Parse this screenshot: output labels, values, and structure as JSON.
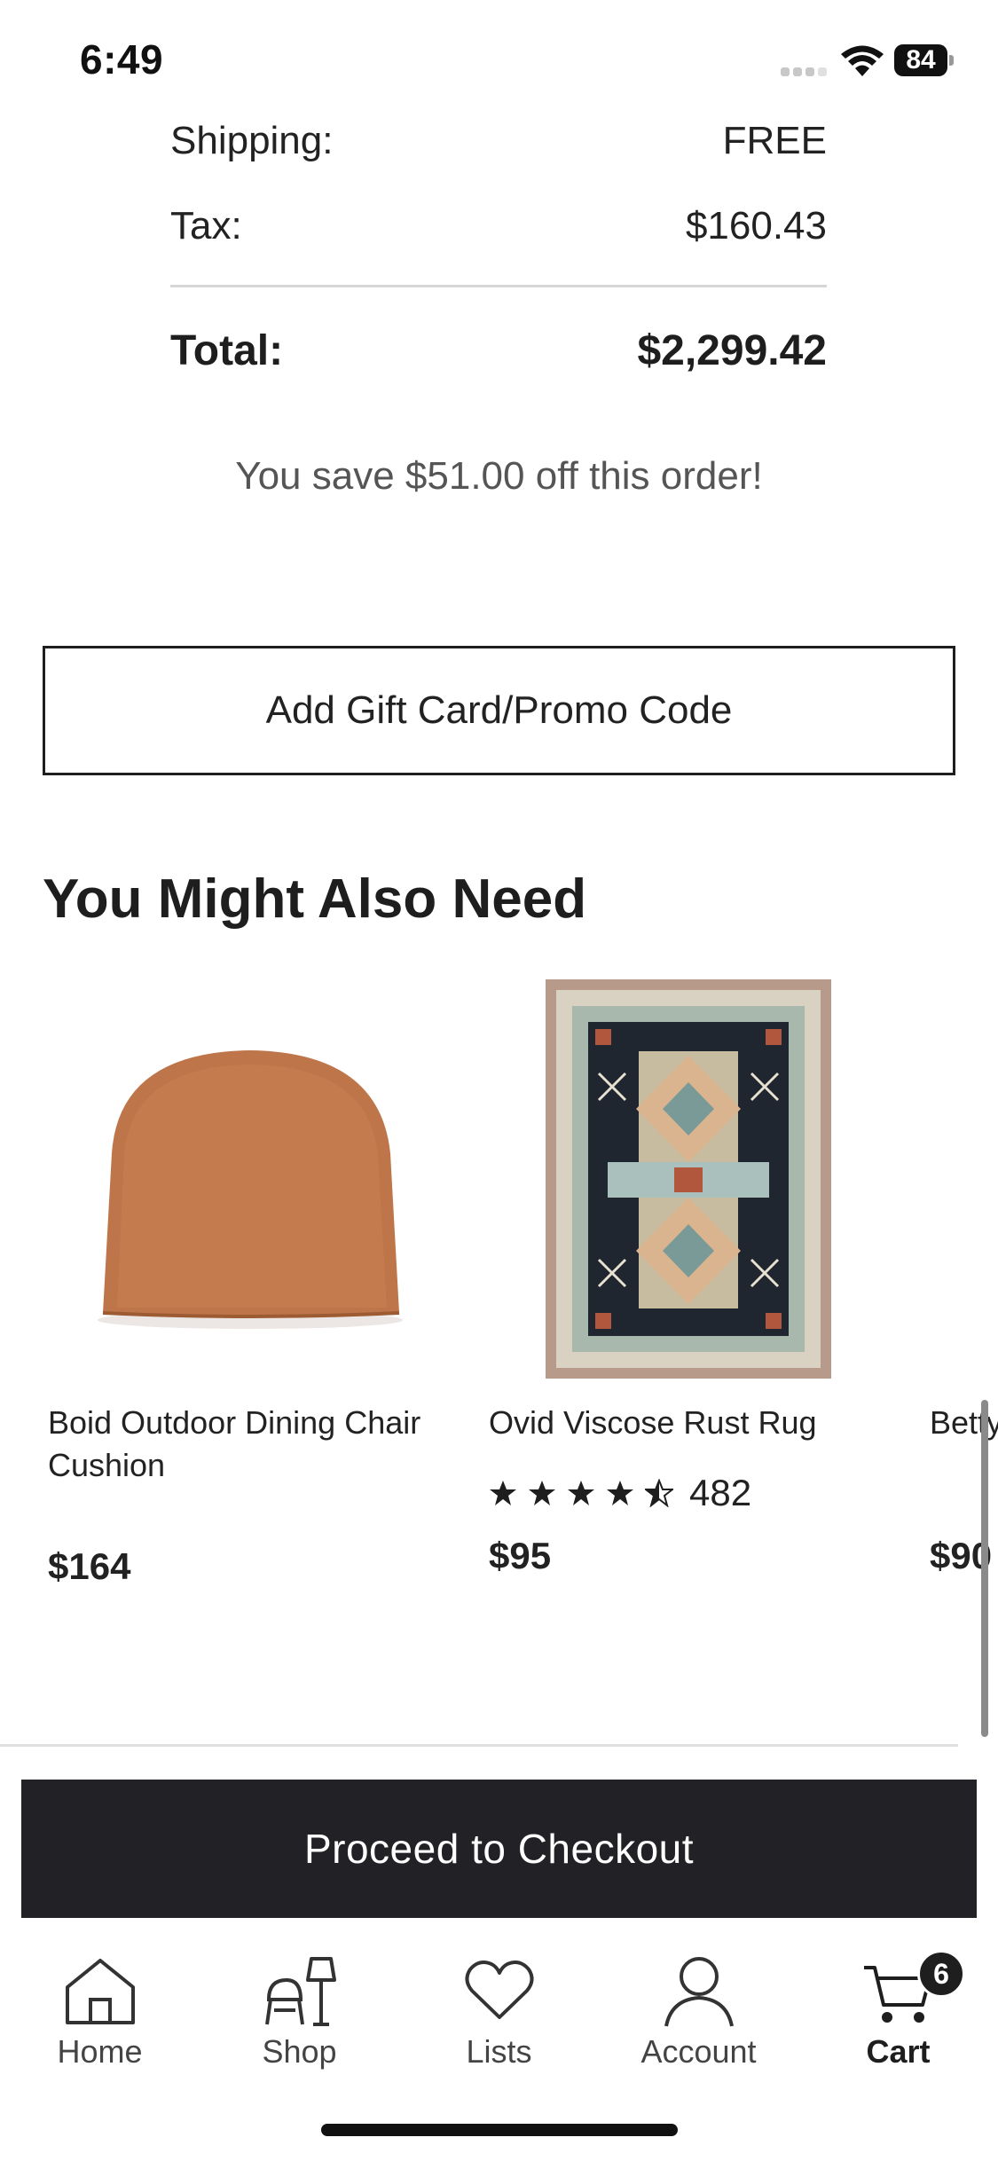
{
  "status_bar": {
    "time": "6:49",
    "battery": "84"
  },
  "summary": {
    "shipping_label": "Shipping:",
    "shipping_value": "FREE",
    "tax_label": "Tax:",
    "tax_value": "$160.43",
    "total_label": "Total:",
    "total_value": "$2,299.42",
    "savings": "You save $51.00 off this order!"
  },
  "promo": {
    "label": "Add Gift Card/Promo Code"
  },
  "recommendations": {
    "title": "You Might Also Need",
    "products": [
      {
        "name": "Boid Outdoor Dining Chair Cushion",
        "price": "$164"
      },
      {
        "name": "Ovid Viscose Rust Rug",
        "rating": 4.5,
        "rating_count": "482",
        "price": "$95"
      },
      {
        "name": "Betty",
        "price": "$90"
      }
    ]
  },
  "checkout": {
    "label": "Proceed to Checkout"
  },
  "tab_bar": {
    "items": [
      {
        "label": "Home",
        "icon": "home-icon"
      },
      {
        "label": "Shop",
        "icon": "shop-icon"
      },
      {
        "label": "Lists",
        "icon": "heart-icon"
      },
      {
        "label": "Account",
        "icon": "account-icon"
      },
      {
        "label": "Cart",
        "icon": "cart-icon",
        "active": true
      }
    ],
    "cart_count": "6"
  }
}
